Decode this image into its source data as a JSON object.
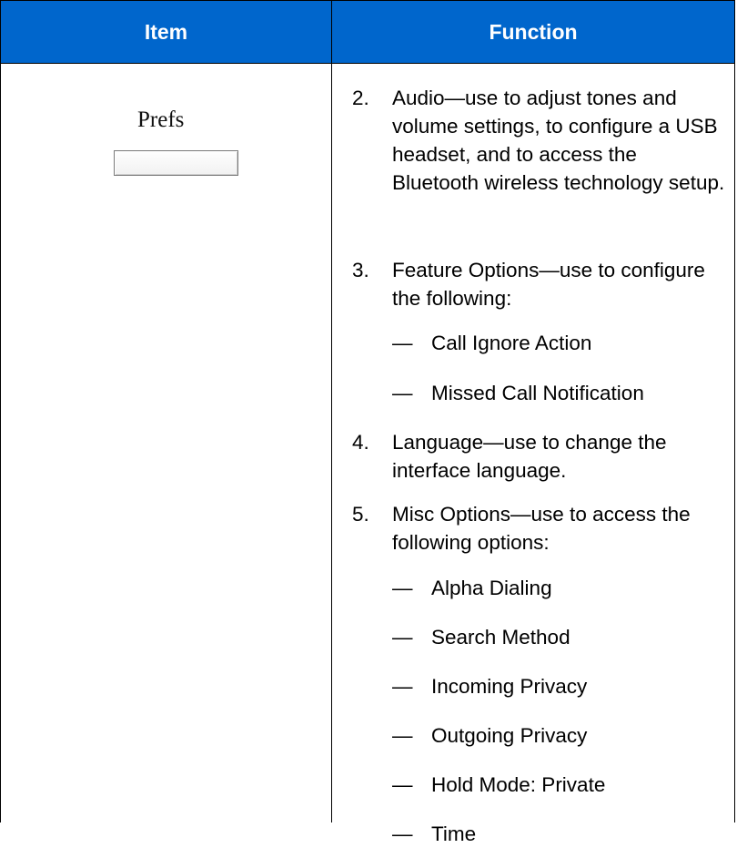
{
  "header": {
    "item_label": "Item",
    "function_label": "Function",
    "background": "#0066cc"
  },
  "item": {
    "label": "Prefs"
  },
  "functions": [
    {
      "number": "2.",
      "text": "Audio—use to adjust tones and volume settings, to configure a USB headset, and to access the Bluetooth wireless technology setup."
    },
    {
      "number": "3.",
      "text": "Feature Options—use to configure the following:"
    },
    {
      "dash": "—",
      "text": "Call Ignore Action"
    },
    {
      "dash": "—",
      "text": "Missed Call Notification"
    },
    {
      "number": "4.",
      "text": "Language—use to change the interface language."
    },
    {
      "number": "5.",
      "text": "Misc Options—use to access the following options:"
    },
    {
      "dash": "—",
      "text": "Alpha Dialing"
    },
    {
      "dash": "—",
      "text": "Search Method"
    },
    {
      "dash": "—",
      "text": "Incoming Privacy"
    },
    {
      "dash": "—",
      "text": "Outgoing Privacy"
    },
    {
      "dash": "—",
      "text": "Hold Mode: Private"
    },
    {
      "dash": "—",
      "text": "Time"
    }
  ]
}
